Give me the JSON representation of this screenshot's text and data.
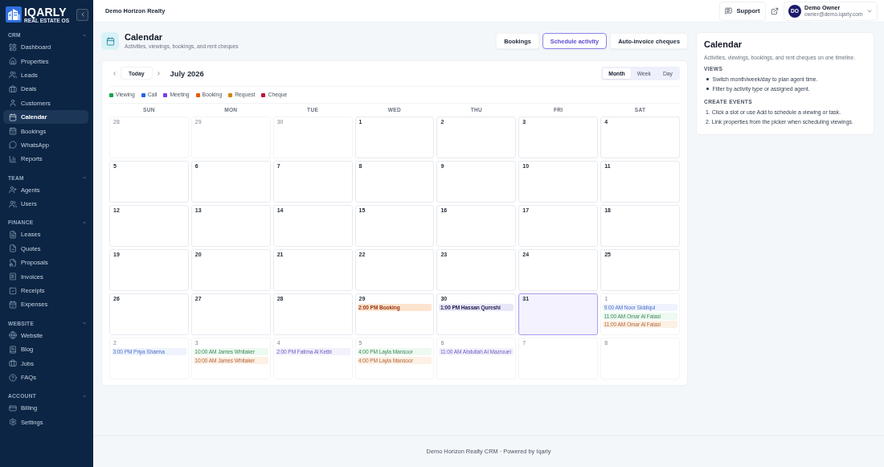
{
  "sidebar": {
    "logo": {
      "name": "IQARLY",
      "tagline": "REAL ESTATE OS"
    },
    "sections": [
      {
        "title": "CRM",
        "expanded": true,
        "items": [
          {
            "label": "Dashboard",
            "selected": false
          },
          {
            "label": "Properties",
            "selected": false
          },
          {
            "label": "Leads",
            "selected": false
          },
          {
            "label": "Deals",
            "selected": false
          },
          {
            "label": "Customers",
            "selected": false
          },
          {
            "label": "Calendar",
            "selected": true
          },
          {
            "label": "Bookings",
            "selected": false
          },
          {
            "label": "WhatsApp",
            "selected": false
          },
          {
            "label": "Reports",
            "selected": false
          }
        ]
      },
      {
        "title": "TEAM",
        "expanded": true,
        "items": [
          {
            "label": "Agents",
            "selected": false
          },
          {
            "label": "Users",
            "selected": false
          }
        ]
      },
      {
        "title": "FINANCE",
        "expanded": true,
        "items": [
          {
            "label": "Leases",
            "selected": false
          },
          {
            "label": "Quotes",
            "selected": false
          },
          {
            "label": "Proposals",
            "selected": false
          },
          {
            "label": "Invoices",
            "selected": false
          },
          {
            "label": "Receipts",
            "selected": false
          },
          {
            "label": "Expenses",
            "selected": false
          }
        ]
      },
      {
        "title": "WEBSITE",
        "expanded": true,
        "items": [
          {
            "label": "Website",
            "selected": false
          },
          {
            "label": "Blog",
            "selected": false
          },
          {
            "label": "Jobs",
            "selected": false
          },
          {
            "label": "FAQs",
            "selected": false
          }
        ]
      },
      {
        "title": "ACCOUNT",
        "expanded": true,
        "items": [
          {
            "label": "Billing",
            "selected": false
          },
          {
            "label": "Settings",
            "selected": false
          }
        ]
      }
    ]
  },
  "topbar": {
    "organization": "Demo Horizon Realty",
    "support": "Support",
    "user": {
      "initials": "DO",
      "name": "Demo Owner",
      "email": "owner@demo.iqarly.com"
    }
  },
  "page": {
    "title": "Calendar",
    "subtitle": "Activities, viewings, bookings, and rent cheques",
    "actions": [
      {
        "label": "Bookings",
        "kind": "plain"
      },
      {
        "label": "Schedule activity",
        "kind": "outline"
      },
      {
        "label": "Auto-invoice cheques",
        "kind": "plain"
      }
    ]
  },
  "calendar": {
    "today_button": "Today",
    "month": "July 2026",
    "views": [
      {
        "label": "Month",
        "selected": true
      },
      {
        "label": "Week",
        "selected": false
      },
      {
        "label": "Day",
        "selected": false
      }
    ],
    "legend": [
      {
        "label": "Viewing",
        "color": "#16a34a"
      },
      {
        "label": "Call",
        "color": "#2563eb"
      },
      {
        "label": "Meeting",
        "color": "#7c3aed"
      },
      {
        "label": "Booking",
        "color": "#ea580c"
      },
      {
        "label": "Request",
        "color": "#ca8a04"
      },
      {
        "label": "Cheque",
        "color": "#be123c"
      }
    ],
    "weekdays": [
      "SUN",
      "MON",
      "TUE",
      "WED",
      "THU",
      "FRI",
      "SAT"
    ],
    "days": [
      {
        "day": "28",
        "in_month": false,
        "today": false
      },
      {
        "day": "29",
        "in_month": false,
        "today": false
      },
      {
        "day": "30",
        "in_month": false,
        "today": false
      },
      {
        "day": "1",
        "in_month": true,
        "today": false
      },
      {
        "day": "2",
        "in_month": true,
        "today": false
      },
      {
        "day": "3",
        "in_month": true,
        "today": false
      },
      {
        "day": "4",
        "in_month": true,
        "today": false
      },
      {
        "day": "5",
        "in_month": true,
        "today": false
      },
      {
        "day": "6",
        "in_month": true,
        "today": false
      },
      {
        "day": "7",
        "in_month": true,
        "today": false
      },
      {
        "day": "8",
        "in_month": true,
        "today": false
      },
      {
        "day": "9",
        "in_month": true,
        "today": false
      },
      {
        "day": "10",
        "in_month": true,
        "today": false
      },
      {
        "day": "11",
        "in_month": true,
        "today": false
      },
      {
        "day": "12",
        "in_month": true,
        "today": false
      },
      {
        "day": "13",
        "in_month": true,
        "today": false
      },
      {
        "day": "14",
        "in_month": true,
        "today": false
      },
      {
        "day": "15",
        "in_month": true,
        "today": false
      },
      {
        "day": "16",
        "in_month": true,
        "today": false
      },
      {
        "day": "17",
        "in_month": true,
        "today": false
      },
      {
        "day": "18",
        "in_month": true,
        "today": false
      },
      {
        "day": "19",
        "in_month": true,
        "today": false
      },
      {
        "day": "20",
        "in_month": true,
        "today": false
      },
      {
        "day": "21",
        "in_month": true,
        "today": false
      },
      {
        "day": "22",
        "in_month": true,
        "today": false
      },
      {
        "day": "23",
        "in_month": true,
        "today": false
      },
      {
        "day": "24",
        "in_month": true,
        "today": false
      },
      {
        "day": "25",
        "in_month": true,
        "today": false
      },
      {
        "day": "26",
        "in_month": true,
        "today": false
      },
      {
        "day": "27",
        "in_month": true,
        "today": false
      },
      {
        "day": "28",
        "in_month": true,
        "today": false
      },
      {
        "day": "29",
        "in_month": true,
        "today": false,
        "events": [
          {
            "text": "2:00 PM Booking",
            "kind": "booking"
          }
        ]
      },
      {
        "day": "30",
        "in_month": true,
        "today": false,
        "events": [
          {
            "text": "1:00 PM Hassan Qureshi",
            "kind": "meeting"
          }
        ]
      },
      {
        "day": "31",
        "in_month": true,
        "today": true
      },
      {
        "day": "1",
        "in_month": false,
        "today": false,
        "events": [
          {
            "text": "9:00 AM Noor Siddiqui",
            "kind": "call"
          },
          {
            "text": "11:00 AM Omar Al Falasi",
            "kind": "viewing"
          },
          {
            "text": "11:00 AM Omar Al Falasi",
            "kind": "booking"
          }
        ]
      },
      {
        "day": "2",
        "in_month": false,
        "today": false,
        "events": [
          {
            "text": "3:00 PM Priya Sharma",
            "kind": "call"
          }
        ]
      },
      {
        "day": "3",
        "in_month": false,
        "today": false,
        "events": [
          {
            "text": "10:00 AM James Whitaker",
            "kind": "viewing"
          },
          {
            "text": "10:00 AM James Whitaker",
            "kind": "booking"
          }
        ]
      },
      {
        "day": "4",
        "in_month": false,
        "today": false,
        "events": [
          {
            "text": "2:00 PM Fatima Al Ketbi",
            "kind": "meeting"
          }
        ]
      },
      {
        "day": "5",
        "in_month": false,
        "today": false,
        "events": [
          {
            "text": "4:00 PM Layla Mansoor",
            "kind": "viewing"
          },
          {
            "text": "4:00 PM Layla Mansoor",
            "kind": "booking"
          }
        ]
      },
      {
        "day": "6",
        "in_month": false,
        "today": false,
        "events": [
          {
            "text": "11:00 AM Abdullah Al Mazrouei",
            "kind": "meeting"
          }
        ]
      },
      {
        "day": "7",
        "in_month": false,
        "today": false
      },
      {
        "day": "8",
        "in_month": false,
        "today": false
      }
    ]
  },
  "help": {
    "title": "Calendar",
    "description": "Activities, viewings, bookings, and rent cheques on one timeline.",
    "sections": [
      {
        "heading": "VIEWS",
        "kind": "bullets",
        "items": [
          "Switch month/week/day to plan agent time.",
          "Filter by activity type or assigned agent."
        ]
      },
      {
        "heading": "CREATE EVENTS",
        "kind": "numbered",
        "items": [
          "1. Click a slot or use Add to schedule a viewing or task.",
          "2. Link properties from the picker when scheduling viewings."
        ]
      }
    ]
  },
  "footer": "Demo Horizon Realty CRM · Powered by Iqarly"
}
